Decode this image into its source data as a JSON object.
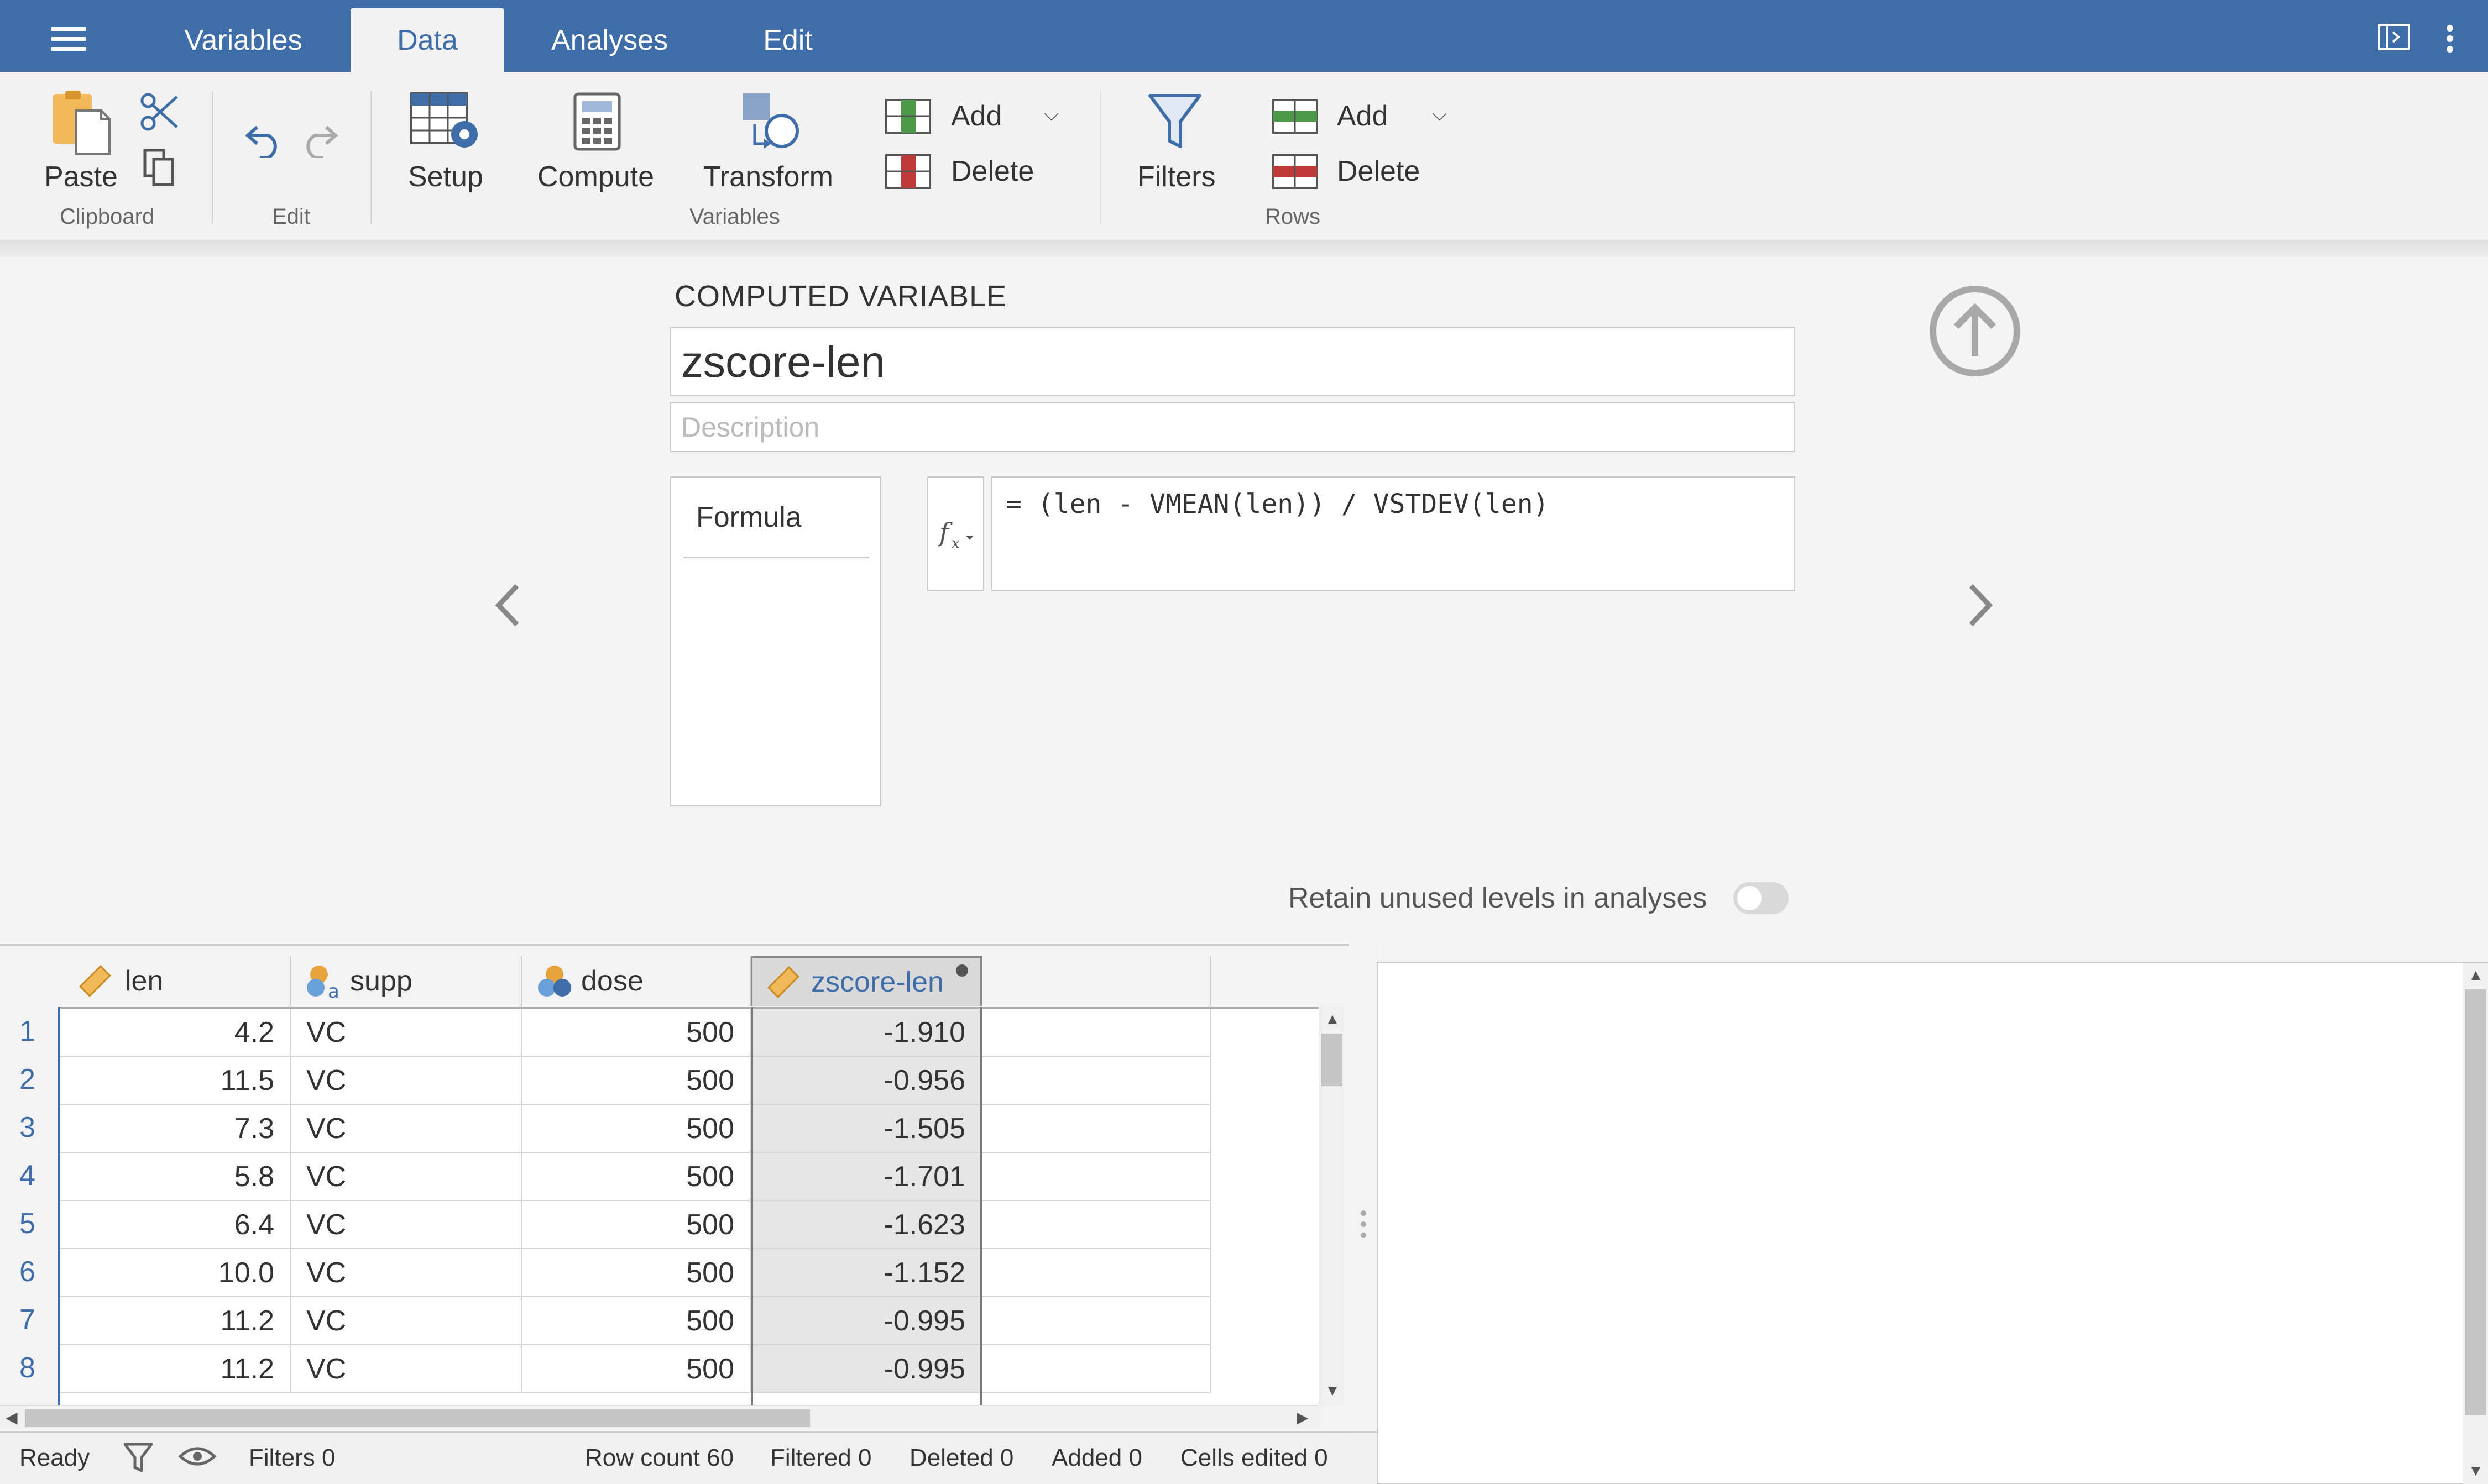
{
  "topbar": {
    "tabs": [
      {
        "label": "Variables"
      },
      {
        "label": "Data"
      },
      {
        "label": "Analyses"
      },
      {
        "label": "Edit"
      }
    ],
    "active_tab": "Data"
  },
  "ribbon": {
    "clipboard": {
      "paste": "Paste",
      "group": "Clipboard"
    },
    "edit": {
      "group": "Edit"
    },
    "variables": {
      "setup": "Setup",
      "compute": "Compute",
      "transform": "Transform",
      "add": "Add",
      "delete": "Delete",
      "group": "Variables"
    },
    "rows": {
      "filters": "Filters",
      "add": "Add",
      "delete": "Delete",
      "group": "Rows"
    }
  },
  "computed_variable": {
    "heading": "COMPUTED VARIABLE",
    "name": "zscore-len",
    "description_placeholder": "Description",
    "formula_label": "Formula",
    "formula": "= (len - VMEAN(len)) / VSTDEV(len)",
    "retain_label": "Retain unused levels in analyses",
    "retain_enabled": false
  },
  "grid": {
    "columns": [
      {
        "name": "len",
        "type": "continuous"
      },
      {
        "name": "supp",
        "type": "nominal-text"
      },
      {
        "name": "dose",
        "type": "nominal"
      },
      {
        "name": "zscore-len",
        "type": "continuous-computed"
      }
    ],
    "rows": [
      {
        "n": "1",
        "len": "4.2",
        "supp": "VC",
        "dose": "500",
        "z": "-1.910"
      },
      {
        "n": "2",
        "len": "11.5",
        "supp": "VC",
        "dose": "500",
        "z": "-0.956"
      },
      {
        "n": "3",
        "len": "7.3",
        "supp": "VC",
        "dose": "500",
        "z": "-1.505"
      },
      {
        "n": "4",
        "len": "5.8",
        "supp": "VC",
        "dose": "500",
        "z": "-1.701"
      },
      {
        "n": "5",
        "len": "6.4",
        "supp": "VC",
        "dose": "500",
        "z": "-1.623"
      },
      {
        "n": "6",
        "len": "10.0",
        "supp": "VC",
        "dose": "500",
        "z": "-1.152"
      },
      {
        "n": "7",
        "len": "11.2",
        "supp": "VC",
        "dose": "500",
        "z": "-0.995"
      },
      {
        "n": "8",
        "len": "11.2",
        "supp": "VC",
        "dose": "500",
        "z": "-0.995"
      }
    ]
  },
  "status": {
    "ready": "Ready",
    "filters": "Filters 0",
    "row_count": "Row count 60",
    "filtered": "Filtered 0",
    "deleted": "Deleted 0",
    "added": "Added 0",
    "cells_edited": "Cells edited 0"
  },
  "colors": {
    "brand": "#3e6da9",
    "add_green": "#4a9a4a",
    "delete_red": "#c03a3a",
    "accent_orange": "#e8a33c"
  }
}
